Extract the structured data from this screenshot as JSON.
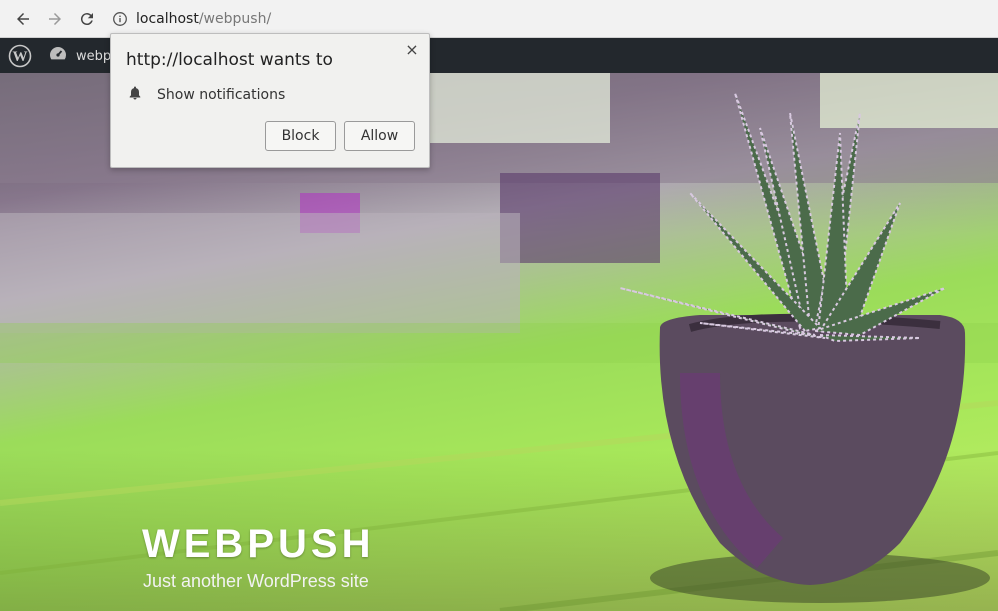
{
  "browser": {
    "url_host": "localhost",
    "url_path": "/webpush/",
    "nav_icons": [
      "back-arrow-icon",
      "forward-arrow-icon",
      "reload-icon",
      "info-icon"
    ]
  },
  "adminbar": {
    "site_name": "webp",
    "icons": [
      "wordpress-logo-icon",
      "dashboard-gauge-icon"
    ]
  },
  "hero": {
    "title": "WEBPUSH",
    "tagline": "Just another WordPress site"
  },
  "permission_popup": {
    "heading": "http://localhost wants to",
    "permission": "Show notifications",
    "block_label": "Block",
    "allow_label": "Allow",
    "close_glyph": "×"
  },
  "colors": {
    "adminbar_bg": "#23282d",
    "toolbar_bg": "#f2f2f2",
    "popup_bg": "#f1f1ef"
  }
}
